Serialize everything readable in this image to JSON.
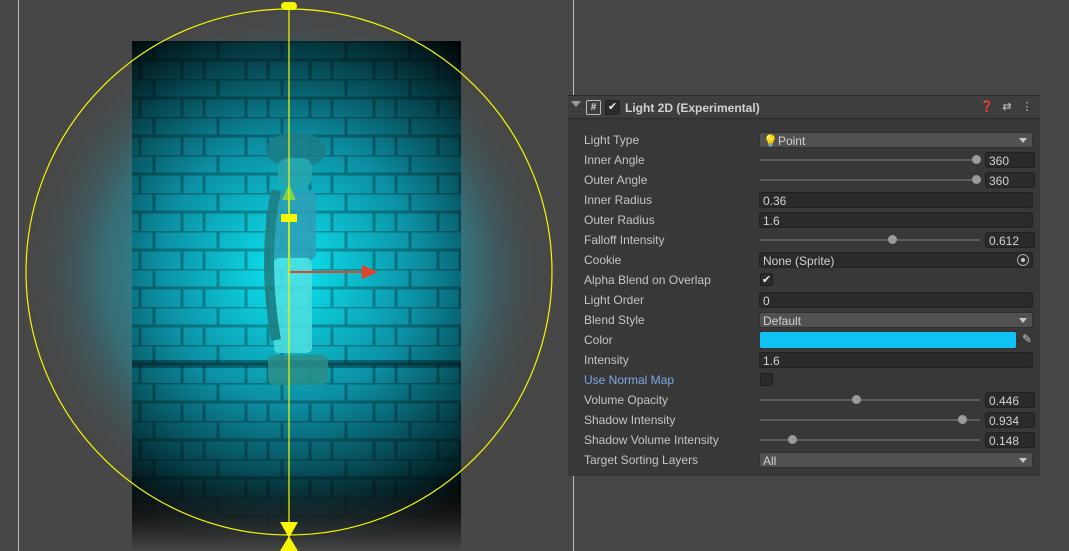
{
  "component": {
    "title": "Light 2D (Experimental)",
    "icon": "script-hash-icon",
    "enabled": true,
    "header_buttons": [
      "help-icon",
      "presets-icon",
      "kebab-menu-icon"
    ]
  },
  "properties": {
    "light_type": {
      "label": "Light Type",
      "value": "Point",
      "icon": "lightbulb-icon"
    },
    "inner_angle": {
      "label": "Inner Angle",
      "value": "360",
      "fraction": 1.0
    },
    "outer_angle": {
      "label": "Outer Angle",
      "value": "360",
      "fraction": 1.0
    },
    "inner_radius": {
      "label": "Inner Radius",
      "value": "0.36"
    },
    "outer_radius": {
      "label": "Outer Radius",
      "value": "1.6"
    },
    "falloff_intensity": {
      "label": "Falloff Intensity",
      "value": "0.612",
      "fraction": 0.612
    },
    "cookie": {
      "label": "Cookie",
      "value": "None (Sprite)"
    },
    "alpha_blend": {
      "label": "Alpha Blend on Overlap",
      "checked": true
    },
    "light_order": {
      "label": "Light Order",
      "value": "0"
    },
    "blend_style": {
      "label": "Blend Style",
      "value": "Default"
    },
    "color": {
      "label": "Color",
      "value": "#0fc3f5"
    },
    "intensity": {
      "label": "Intensity",
      "value": "1.6"
    },
    "use_normal_map": {
      "label": "Use Normal Map",
      "checked": false
    },
    "volume_opacity": {
      "label": "Volume Opacity",
      "value": "0.446",
      "fraction": 0.446
    },
    "shadow_intensity": {
      "label": "Shadow Intensity",
      "value": "0.934",
      "fraction": 0.934
    },
    "shadow_volume_intensity": {
      "label": "Shadow Volume Intensity",
      "value": "0.148",
      "fraction": 0.148
    },
    "target_sorting_layers": {
      "label": "Target Sorting Layers",
      "value": "All"
    }
  },
  "colors": {
    "editor_bg": "#474747",
    "panel_bg": "#383838",
    "light_color": "#0fc3f5",
    "gizmo": "#f7f700",
    "transform_x": "#e0452c",
    "transform_y": "#7cd04a"
  }
}
